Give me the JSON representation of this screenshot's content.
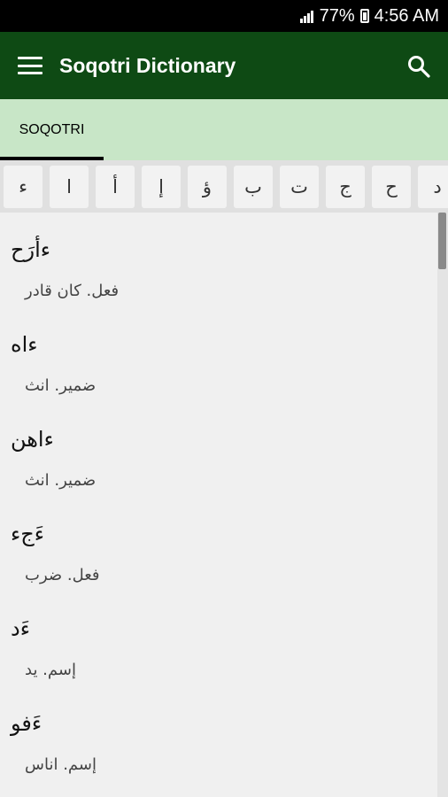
{
  "status_bar": {
    "battery": "77%",
    "time": "4:56 AM"
  },
  "app_bar": {
    "title": "Soqotri Dictionary"
  },
  "tabs": [
    {
      "label": "SOQOTRI"
    }
  ],
  "letters": [
    "ء",
    "ا",
    "أ",
    "إ",
    "ؤ",
    "ب",
    "ت",
    "ج",
    "ح",
    "د"
  ],
  "entries": [
    {
      "word": "ءأرَح",
      "definition": "فعل. كان قادر"
    },
    {
      "word": "ءاه",
      "definition": "ضمير. انث"
    },
    {
      "word": "ءاهن",
      "definition": "ضمير. انث"
    },
    {
      "word": "ءَجء",
      "definition": "فعل. ضرب"
    },
    {
      "word": "ءَد",
      "definition": "إسم. يد"
    },
    {
      "word": "ءَفو",
      "definition": "إسم. اناس"
    }
  ],
  "colors": {
    "app_bar": "#0e4a14",
    "tab_bar": "#c8e6c7",
    "status_bar": "#000000"
  }
}
